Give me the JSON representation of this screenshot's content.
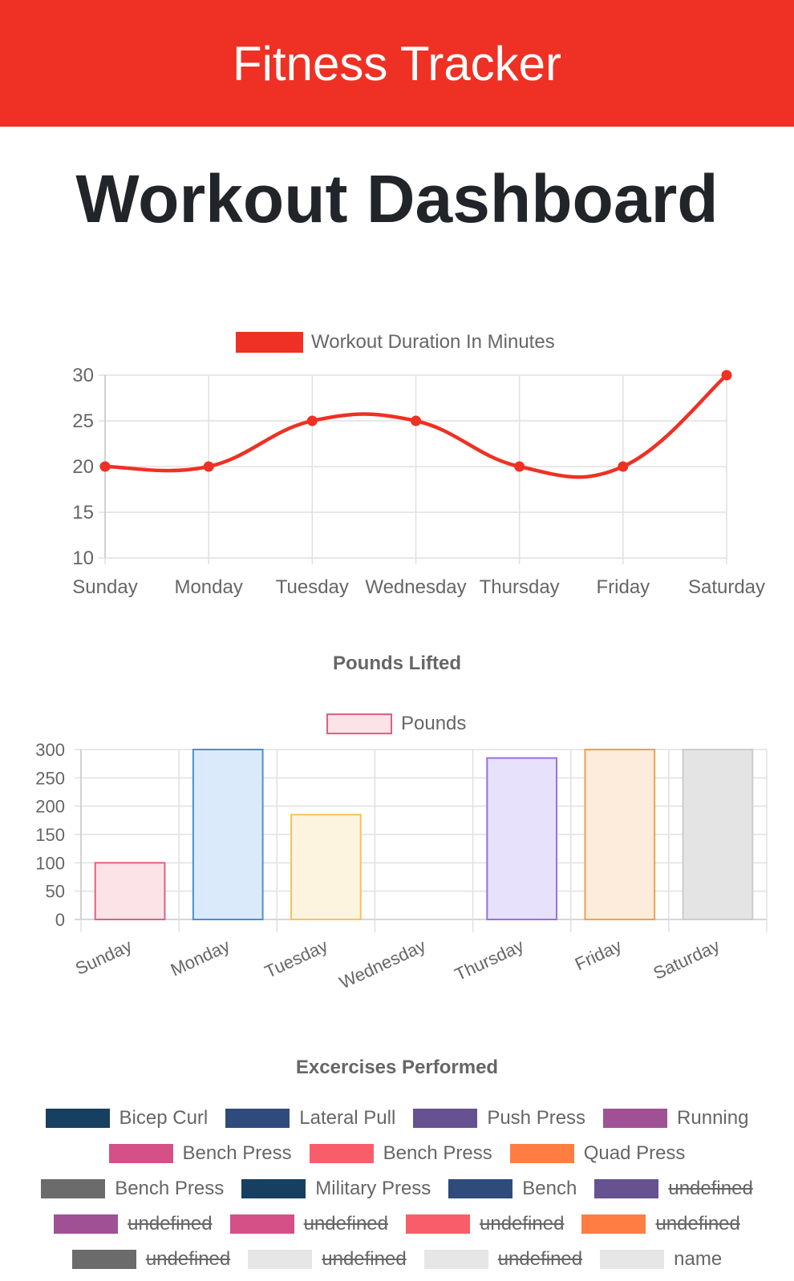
{
  "navbar": {
    "brand": "Fitness Tracker"
  },
  "page": {
    "title": "Workout Dashboard"
  },
  "colors": {
    "brand_red": "#ee3124",
    "grid": "#e0e0e0",
    "text": "#666666"
  },
  "chart_data": [
    {
      "type": "line",
      "title": "",
      "legend": {
        "position": "top",
        "entries": [
          "Workout Duration In Minutes"
        ]
      },
      "categories": [
        "Sunday",
        "Monday",
        "Tuesday",
        "Wednesday",
        "Thursday",
        "Friday",
        "Saturday"
      ],
      "series": [
        {
          "name": "Workout Duration In Minutes",
          "color": "#ee3124",
          "values": [
            20,
            20,
            25,
            25,
            20,
            20,
            30
          ]
        }
      ],
      "ylim": [
        10,
        30
      ],
      "yticks": [
        30,
        25,
        20,
        15,
        10
      ],
      "grid": true
    },
    {
      "type": "bar",
      "title": "Pounds Lifted",
      "legend": {
        "position": "top",
        "entries": [
          "Pounds"
        ]
      },
      "categories": [
        "Sunday",
        "Monday",
        "Tuesday",
        "Wednesday",
        "Thursday",
        "Friday",
        "Saturday"
      ],
      "series": [
        {
          "name": "Pounds",
          "values": [
            100,
            300,
            185,
            0,
            285,
            300,
            300
          ]
        }
      ],
      "bar_fills": [
        "#fbe3e8",
        "#dbeafb",
        "#fcf4df",
        "#eeeeee",
        "#e7e1fb",
        "#fdecdc",
        "#e4e4e4"
      ],
      "bar_borders": [
        "#e06080",
        "#4a90d9",
        "#f5c35a",
        "#bbbbbb",
        "#9a6fe0",
        "#f0a050",
        "#cccccc"
      ],
      "ylim": [
        0,
        300
      ],
      "yticks": [
        300,
        250,
        200,
        150,
        100,
        50,
        0
      ],
      "grid": true
    },
    {
      "type": "pie",
      "title": "Excercises Performed",
      "legend": {
        "position": "top",
        "entries": [
          {
            "label": "Bicep Curl",
            "color": "#173f5f",
            "hidden": false
          },
          {
            "label": "Lateral Pull",
            "color": "#2f4b7c",
            "hidden": false
          },
          {
            "label": "Push Press",
            "color": "#665191",
            "hidden": false
          },
          {
            "label": "Running",
            "color": "#a05195",
            "hidden": false
          },
          {
            "label": "Bench Press",
            "color": "#d45087",
            "hidden": false
          },
          {
            "label": "Bench Press",
            "color": "#f95d6a",
            "hidden": false
          },
          {
            "label": "Quad Press",
            "color": "#ff7c43",
            "hidden": false
          },
          {
            "label": "Bench Press",
            "color": "#6b6b6b",
            "hidden": false
          },
          {
            "label": "Military Press",
            "color": "#173f5f",
            "hidden": false
          },
          {
            "label": "Bench",
            "color": "#2f4b7c",
            "hidden": false
          },
          {
            "label": "undefined",
            "color": "#665191",
            "hidden": true
          },
          {
            "label": "undefined",
            "color": "#a05195",
            "hidden": true
          },
          {
            "label": "undefined",
            "color": "#d45087",
            "hidden": true
          },
          {
            "label": "undefined",
            "color": "#f95d6a",
            "hidden": true
          },
          {
            "label": "undefined",
            "color": "#ff7c43",
            "hidden": true
          },
          {
            "label": "undefined",
            "color": "#6b6b6b",
            "hidden": true
          },
          {
            "label": "undefined",
            "color": "#e6e6e6",
            "hidden": true
          },
          {
            "label": "undefined",
            "color": "#e6e6e6",
            "hidden": true
          },
          {
            "label": "name",
            "color": "#e6e6e6",
            "hidden": false
          }
        ]
      }
    }
  ]
}
